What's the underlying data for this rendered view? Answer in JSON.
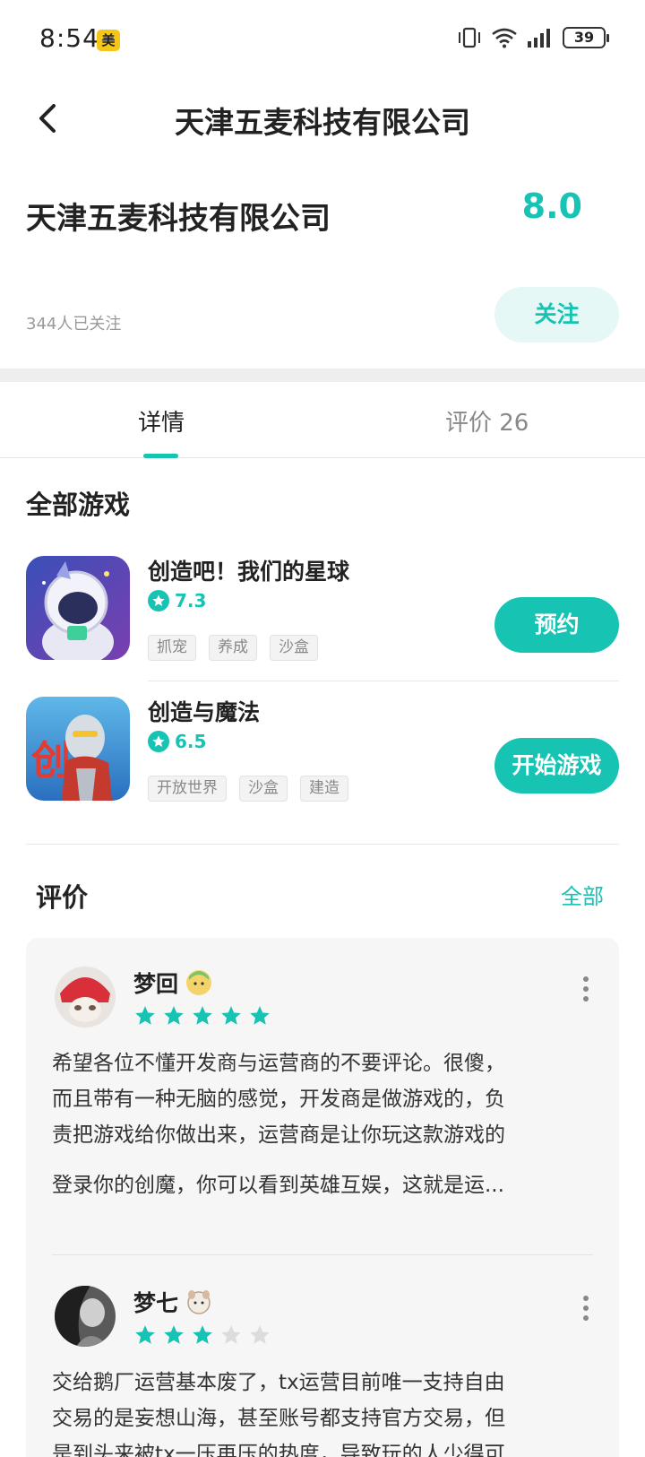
{
  "status_bar": {
    "time": "8:54",
    "badge": "美",
    "battery": "39"
  },
  "header": {
    "title": "天津五麦科技有限公司"
  },
  "company": {
    "name": "天津五麦科技有限公司",
    "score": "8.0",
    "followers": "344人已关注",
    "follow_label": "关注"
  },
  "tabs": [
    {
      "label": "详情"
    },
    {
      "label": "评价 26"
    }
  ],
  "games_section": {
    "title": "全部游戏",
    "games": [
      {
        "name": "创造吧！我们的星球",
        "rating": "7.3",
        "tags": [
          "抓宠",
          "养成",
          "沙盒"
        ],
        "button": "预约"
      },
      {
        "name": "创造与魔法",
        "rating": "6.5",
        "tags": [
          "开放世界",
          "沙盒",
          "建造"
        ],
        "button": "开始游戏"
      }
    ]
  },
  "reviews_section": {
    "title": "评价",
    "all_label": "全部",
    "reviews": [
      {
        "name": "梦回",
        "stars": 5,
        "lines": [
          "希望各位不懂开发商与运营商的不要评论。很傻，",
          "而且带有一种无脑的感觉，开发商是做游戏的，负",
          "责把游戏给你做出来，运营商是让你玩这款游戏的",
          "登录你的创魔，你可以看到英雄互娱，这就是运..."
        ]
      },
      {
        "name": "梦七",
        "stars": 3,
        "lines": [
          "交给鹅厂运营基本废了，tx运营目前唯一支持自由",
          "交易的是妄想山海，甚至账号都支持官方交易，但",
          "是到头来被tx一压再压的热度，导致玩的人少得可"
        ]
      }
    ]
  },
  "colors": {
    "accent": "#17c3b2",
    "accent_light": "#e5f8f6"
  }
}
